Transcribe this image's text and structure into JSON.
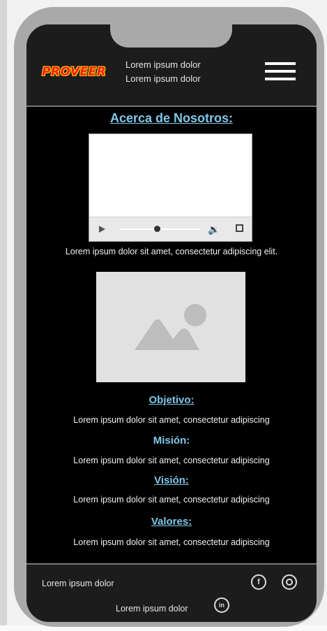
{
  "header": {
    "logo": "PROVEER",
    "line1": "Lorem ipsum dolor",
    "line2": "Lorem ipsum dolor"
  },
  "main": {
    "title": "Acerca de Nosotros:",
    "video_caption": "Lorem ipsum dolor sit amet, consectetur adipiscing elit.",
    "sections": [
      {
        "heading": "Objetivo:",
        "text": "Lorem ipsum dolor sit amet, consectetur adipiscing"
      },
      {
        "heading": "Misión:",
        "text": "Lorem ipsum dolor sit amet, consectetur adipiscing"
      },
      {
        "heading": "Visión:",
        "text": "Lorem ipsum dolor sit amet, consectetur adipiscing"
      },
      {
        "heading": "Valores:",
        "text": "Lorem ipsum dolor sit amet, consectetur adipiscing"
      }
    ]
  },
  "footer": {
    "text1": "Lorem ipsum dolor",
    "text2": "Lorem ipsum dolor",
    "icons": [
      "facebook-icon",
      "instagram-icon",
      "linkedin-icon"
    ]
  },
  "colors": {
    "accent": "#7fc8ea",
    "header_bg": "#1c1c1c",
    "screen_bg": "#000000",
    "frame": "#a9a9a9",
    "logo_red": "#ff1a1a",
    "logo_yellow": "#ffcc00"
  }
}
